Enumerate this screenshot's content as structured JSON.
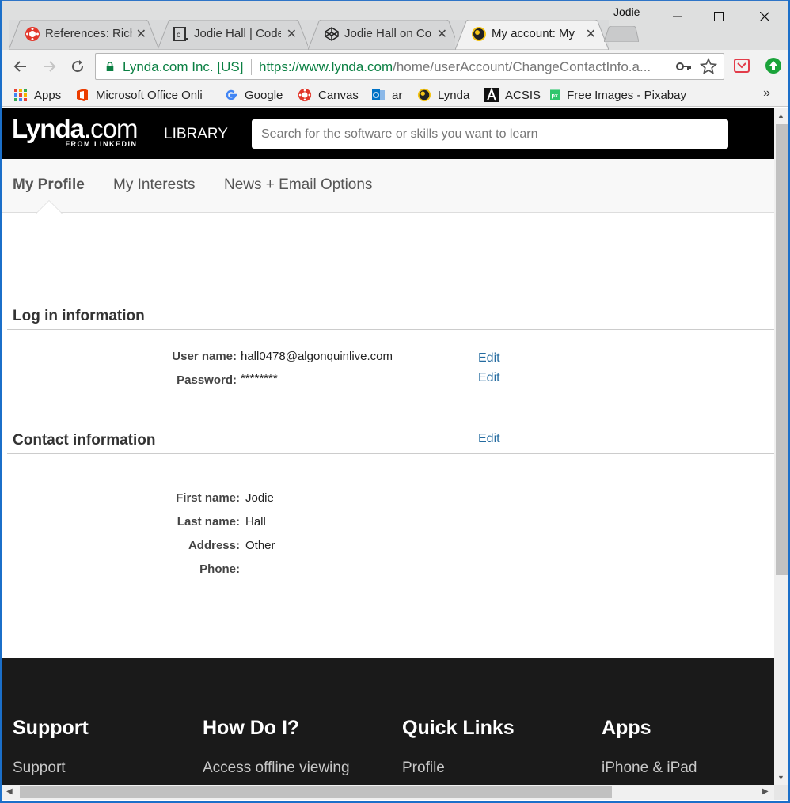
{
  "browser": {
    "profile_name": "Jodie",
    "tabs": [
      {
        "title": "References: Rich",
        "icon": "canvas-icon"
      },
      {
        "title": "Jodie Hall | Code",
        "icon": "codepen-icon"
      },
      {
        "title": "Jodie Hall on Co",
        "icon": "codepen-cube-icon"
      },
      {
        "title": "My account: My",
        "icon": "lynda-icon",
        "active": true
      }
    ],
    "close_glyph": "✕",
    "address": {
      "site_identity": "Lynda.com Inc. [US]",
      "url_scheme_host": "https://www.lynda.com",
      "url_path": "/home/userAccount/ChangeContactInfo.a..."
    },
    "bookmarks": [
      {
        "label": "Apps",
        "icon": "apps-grid-icon"
      },
      {
        "label": "Microsoft Office Onli",
        "icon": "office-icon"
      },
      {
        "label": "Google",
        "icon": "google-icon"
      },
      {
        "label": "Canvas",
        "icon": "canvas-icon"
      },
      {
        "label": "ar",
        "icon": "outlook-icon"
      },
      {
        "label": "Lynda",
        "icon": "lynda-icon"
      },
      {
        "label": "ACSIS",
        "icon": "acsis-icon"
      },
      {
        "label": "Free Images - Pixabay",
        "icon": "pixabay-icon"
      }
    ],
    "bookmarks_more": "»"
  },
  "site": {
    "logo_main": "Lynda",
    "logo_suffix": ".com",
    "logo_sub": "FROM LINKEDIN",
    "library_label": "LIBRARY",
    "search_placeholder": "Search for the software or skills you want to learn"
  },
  "profile_tabs": [
    {
      "label": "My Profile",
      "active": true
    },
    {
      "label": "My Interests"
    },
    {
      "label": "News + Email Options"
    }
  ],
  "login_section": {
    "title": "Log in information",
    "username_label": "User name:",
    "username_value": "hall0478@algonquinlive.com",
    "password_label": "Password:",
    "password_value": "********",
    "edit_label": "Edit"
  },
  "contact_section": {
    "title": "Contact information",
    "edit_label": "Edit",
    "first_name_label": "First name:",
    "first_name_value": "Jodie",
    "last_name_label": "Last name:",
    "last_name_value": "Hall",
    "address_label": "Address:",
    "address_value": "Other",
    "phone_label": "Phone:",
    "phone_value": ""
  },
  "footer": {
    "columns": [
      {
        "heading": "Support",
        "link": "Support"
      },
      {
        "heading": "How Do I?",
        "link": "Access offline viewing"
      },
      {
        "heading": "Quick Links",
        "link": "Profile"
      },
      {
        "heading": "Apps",
        "link": "iPhone & iPad"
      }
    ]
  },
  "colors": {
    "link": "#246ba0",
    "secure_green": "#0b8043",
    "header_bg": "#000000",
    "footer_bg": "#1a1a1a"
  }
}
